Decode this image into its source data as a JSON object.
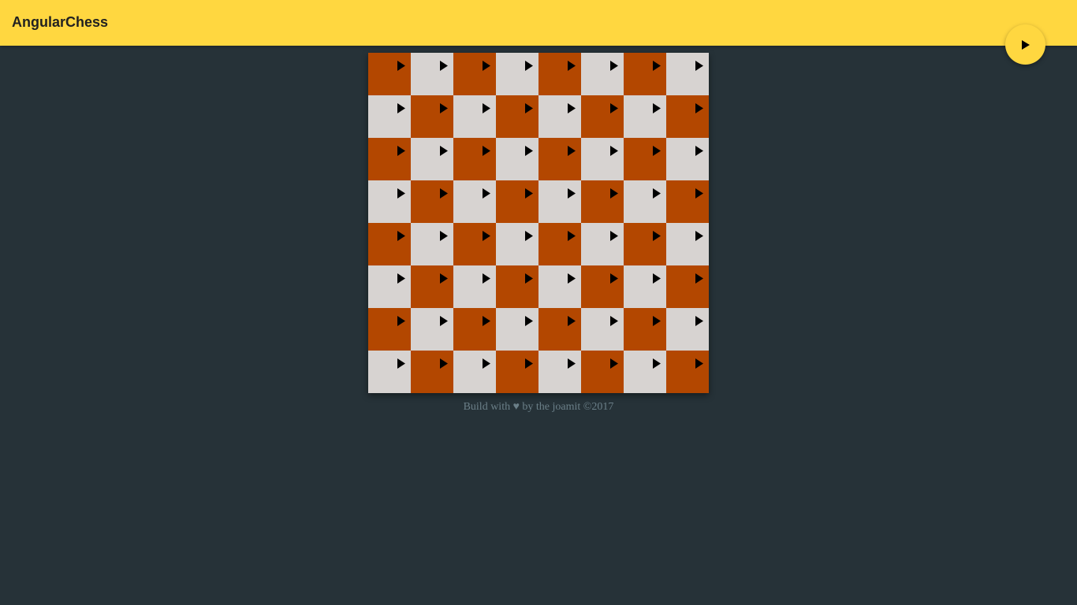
{
  "header": {
    "title": "AngularChess",
    "background": "#ffd740"
  },
  "fab": {
    "icon": "play-arrow-icon"
  },
  "board": {
    "size": 8,
    "colors": {
      "dark": "#b34700",
      "light": "#d7d3d1"
    },
    "first_square": "dark",
    "square_icon": "play-arrow-icon"
  },
  "footer": {
    "text": "Build with ♥ by the joamit ©2017"
  },
  "page": {
    "background": "#263238"
  }
}
